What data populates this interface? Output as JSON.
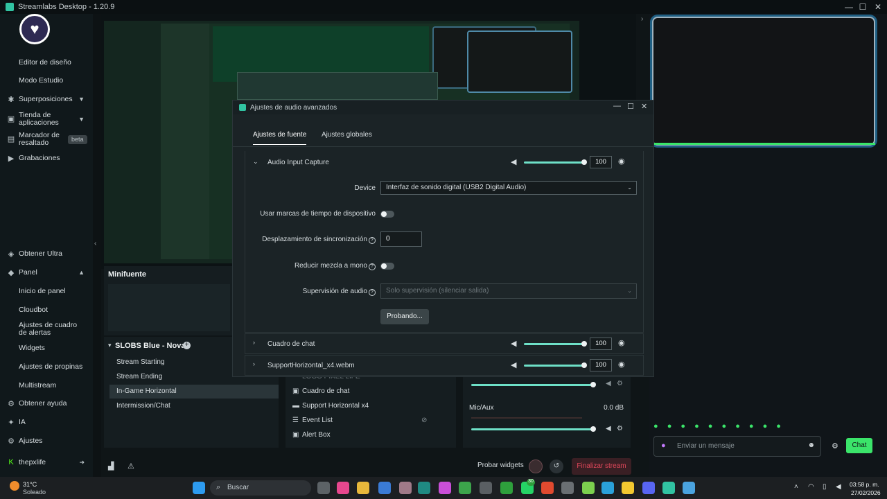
{
  "window": {
    "title": "Streamlabs Desktop - 1.20.9",
    "minimize_icon": "minimize-icon",
    "maximize_icon": "maximize-icon",
    "close_icon": "close-icon"
  },
  "sidebar": {
    "items": [
      {
        "label": "Editor de diseño"
      },
      {
        "label": "Modo Estudio"
      },
      {
        "label": "Superposiciones"
      },
      {
        "label": "Tienda de aplicaciones"
      },
      {
        "label": "Marcador de resaltado",
        "badge": "beta"
      },
      {
        "label": "Grabaciones"
      },
      {
        "label": "Obtener Ultra"
      },
      {
        "label": "Panel"
      },
      {
        "label": "Inicio de panel"
      },
      {
        "label": "Cloudbot"
      },
      {
        "label": "Ajustes de cuadro de alertas"
      },
      {
        "label": "Widgets"
      },
      {
        "label": "Ajustes de propinas"
      },
      {
        "label": "Multistream"
      },
      {
        "label": "Obtener ayuda"
      },
      {
        "label": "IA"
      },
      {
        "label": "Ajustes"
      },
      {
        "label": "thepxlife"
      }
    ]
  },
  "minifuente": {
    "title": "Minifuente"
  },
  "scenes": {
    "collection": "SLOBS Blue - Nova",
    "items": [
      "Stream Starting",
      "Stream Ending",
      "In-Game Horizontal",
      "Intermission/Chat"
    ],
    "active_index": 2
  },
  "sources": {
    "items": [
      "LOGO PIXEL LIFE",
      "Cuadro de chat",
      "Support Horizontal x4",
      "Event List",
      "Alert Box"
    ]
  },
  "mixer": {
    "channel": "Mic/Aux",
    "db": "0.0 dB"
  },
  "modal": {
    "title": "Ajustes de audio avanzados",
    "tabs": [
      "Ajustes de fuente",
      "Ajustes globales"
    ],
    "active_tab": 0,
    "source_rows": [
      {
        "name": "Audio Input Capture",
        "volume": "100",
        "expanded": true
      },
      {
        "name": "Cuadro de chat",
        "volume": "100",
        "expanded": false
      },
      {
        "name": "SupportHorizontal_x4.webm",
        "volume": "100",
        "expanded": false
      }
    ],
    "device_label": "Device",
    "device_value": "Interfaz de sonido digital (USB2 Digital Audio)",
    "timestamps_label": "Usar marcas de tiempo de dispositivo",
    "sync_label": "Desplazamiento de sincronización",
    "sync_value": "0",
    "mono_label": "Reducir mezcla a mono",
    "monitor_label": "Supervisión de audio",
    "monitor_value": "Solo supervisión (silenciar salida)",
    "test_button": "Probando..."
  },
  "chat": {
    "placeholder": "Enviar un mensaje",
    "send_label": "Chat"
  },
  "bottom": {
    "test_widgets": "Probar widgets",
    "end_stream": "Finalizar stream"
  },
  "taskbar": {
    "weather_temp": "31°C",
    "weather_desc": "Soleado",
    "search": "Buscar",
    "time": "03:58 p. m.",
    "date": "27/02/2026",
    "badge_count": "30"
  },
  "colors": {
    "accent": "#31c3a2",
    "end_stream": "#e0475a",
    "chat_button": "#3be46a"
  }
}
